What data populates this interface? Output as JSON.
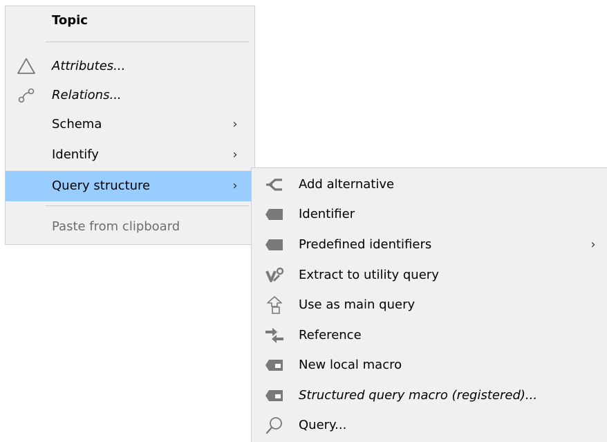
{
  "main_menu": {
    "header": "Topic",
    "items": [
      {
        "label": "Attributes...",
        "icon": "triangle-icon"
      },
      {
        "label": "Relations...",
        "icon": "relations-icon"
      },
      {
        "label": "Schema",
        "submenu": "›"
      },
      {
        "label": "Identify",
        "submenu": "›"
      },
      {
        "label": "Query structure",
        "submenu": "›"
      },
      {
        "label": "Paste from clipboard"
      }
    ]
  },
  "sub_menu": {
    "items": [
      {
        "label": "Add alternative",
        "icon": "add-alternative-icon"
      },
      {
        "label": "Identifier",
        "icon": "identifier-tag-icon"
      },
      {
        "label": "Predefined identifiers",
        "icon": "identifier-tag-icon",
        "submenu": "›"
      },
      {
        "label": "Extract to utility query",
        "icon": "extract-icon"
      },
      {
        "label": "Use as main query",
        "icon": "use-main-query-icon"
      },
      {
        "label": "Reference",
        "icon": "reference-arrows-icon"
      },
      {
        "label": "New local macro",
        "icon": "macro-tag-icon"
      },
      {
        "label": "Structured query macro (registered)...",
        "icon": "macro-tag-icon"
      },
      {
        "label": "Query...",
        "icon": "search-icon"
      }
    ]
  },
  "colors": {
    "menu_bg": "#f0f0f0",
    "highlight": "#99ccff",
    "icon_gray": "#7a7a7a",
    "disabled_text": "#6d6d6d"
  }
}
